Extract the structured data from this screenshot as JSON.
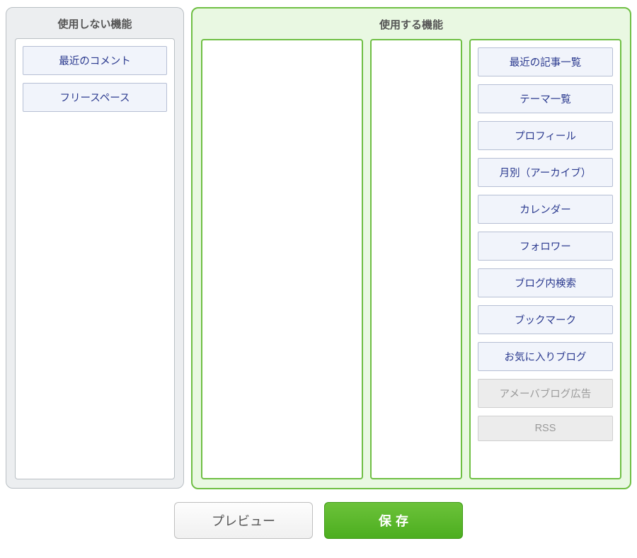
{
  "panels": {
    "unused": {
      "title": "使用しない機能"
    },
    "used": {
      "title": "使用する機能"
    }
  },
  "unused_items": [
    {
      "label": "最近のコメント",
      "disabled": false
    },
    {
      "label": "フリースペース",
      "disabled": false
    }
  ],
  "used_col_c": [
    {
      "label": "最近の記事一覧",
      "disabled": false
    },
    {
      "label": "テーマ一覧",
      "disabled": false
    },
    {
      "label": "プロフィール",
      "disabled": false
    },
    {
      "label": "月別（アーカイブ）",
      "disabled": false
    },
    {
      "label": "カレンダー",
      "disabled": false
    },
    {
      "label": "フォロワー",
      "disabled": false
    },
    {
      "label": "ブログ内検索",
      "disabled": false
    },
    {
      "label": "ブックマーク",
      "disabled": false
    },
    {
      "label": "お気に入りブログ",
      "disabled": false
    },
    {
      "label": "アメーバブログ広告",
      "disabled": true
    },
    {
      "label": "RSS",
      "disabled": true
    }
  ],
  "actions": {
    "preview": "プレビュー",
    "save": "保存"
  }
}
